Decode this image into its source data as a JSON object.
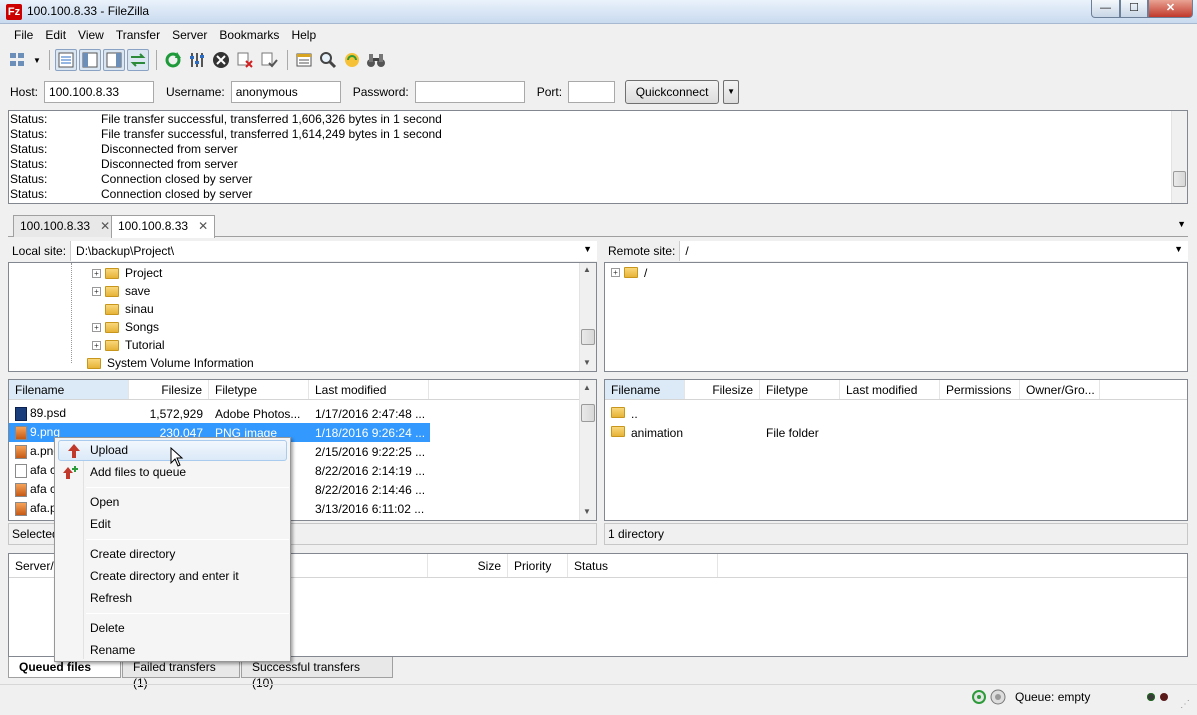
{
  "window": {
    "title": "100.100.8.33 - FileZilla",
    "app_icon_text": "Fz",
    "minimize": "—",
    "maximize": "☐",
    "close": "✕"
  },
  "menu": [
    "File",
    "Edit",
    "View",
    "Transfer",
    "Server",
    "Bookmarks",
    "Help"
  ],
  "quickconnect": {
    "host_label": "Host:",
    "host_value": "100.100.8.33",
    "username_label": "Username:",
    "username_value": "anonymous",
    "password_label": "Password:",
    "password_value": "",
    "port_label": "Port:",
    "port_value": "",
    "button_label": "Quickconnect"
  },
  "log": [
    {
      "type": "Status:",
      "msg": "File transfer successful, transferred 1,606,326 bytes in 1 second"
    },
    {
      "type": "Status:",
      "msg": "File transfer successful, transferred 1,614,249 bytes in 1 second"
    },
    {
      "type": "Status:",
      "msg": "Disconnected from server"
    },
    {
      "type": "Status:",
      "msg": "Disconnected from server"
    },
    {
      "type": "Status:",
      "msg": "Connection closed by server"
    },
    {
      "type": "Status:",
      "msg": "Connection closed by server"
    }
  ],
  "tabs": [
    {
      "label": "100.100.8.33",
      "close": "✕"
    },
    {
      "label": "100.100.8.33",
      "close": "✕"
    }
  ],
  "local": {
    "site_label": "Local site:",
    "path": "D:\\backup\\Project\\",
    "tree": [
      {
        "label": "Project",
        "expander": "+"
      },
      {
        "label": "save",
        "expander": "+"
      },
      {
        "label": "sinau",
        "expander": ""
      },
      {
        "label": "Songs",
        "expander": "+"
      },
      {
        "label": "Tutorial",
        "expander": "+"
      },
      {
        "label": "System Volume Information",
        "expander": ""
      }
    ],
    "columns": [
      "Filename",
      "Filesize",
      "Filetype",
      "Last modified"
    ],
    "files": [
      {
        "name": "89.psd",
        "size": "1,572,929",
        "type": "Adobe Photos...",
        "modified": "1/17/2016 2:47:48 ..."
      },
      {
        "name": "9.png",
        "size": "230,047",
        "type": "PNG image",
        "modified": "1/18/2016 9:26:24 ..."
      },
      {
        "name": "a.png",
        "size": "",
        "type": "",
        "modified": "2/15/2016 9:22:25 ..."
      },
      {
        "name": "afa c",
        "size": "",
        "type": "",
        "modified": "8/22/2016 2:14:19 ..."
      },
      {
        "name": "afa c",
        "size": "",
        "type": "",
        "modified": "8/22/2016 2:14:46 ..."
      },
      {
        "name": "afa.p",
        "size": "",
        "type": "",
        "modified": "3/13/2016 6:11:02 ..."
      }
    ],
    "status": "Selected"
  },
  "remote": {
    "site_label": "Remote site:",
    "path": "/",
    "tree_root": "/",
    "columns": [
      "Filename",
      "Filesize",
      "Filetype",
      "Last modified",
      "Permissions",
      "Owner/Gro..."
    ],
    "files": [
      {
        "name": "..",
        "type": ""
      },
      {
        "name": "animation",
        "type": "File folder"
      }
    ],
    "status": "1 directory"
  },
  "queue": {
    "columns": [
      "Server/L",
      "e file",
      "Size",
      "Priority",
      "Status"
    ],
    "tabs": [
      "Queued files",
      "Failed transfers (1)",
      "Successful transfers (10)"
    ]
  },
  "statusbar": {
    "queue": "Queue: empty"
  },
  "context_menu": [
    {
      "label": "Upload",
      "icon": "upload-arrow-icon"
    },
    {
      "label": "Add files to queue",
      "icon": "add-to-queue-icon"
    },
    {
      "label": "Open"
    },
    {
      "label": "Edit"
    },
    {
      "label": "Create directory"
    },
    {
      "label": "Create directory and enter it"
    },
    {
      "label": "Refresh"
    },
    {
      "label": "Delete"
    },
    {
      "label": "Rename"
    }
  ],
  "colors": {
    "selection": "#3399ff",
    "folder": "#e6b337",
    "upload_arrow": "#c0392b",
    "add_queue": "#2e9b3a"
  }
}
